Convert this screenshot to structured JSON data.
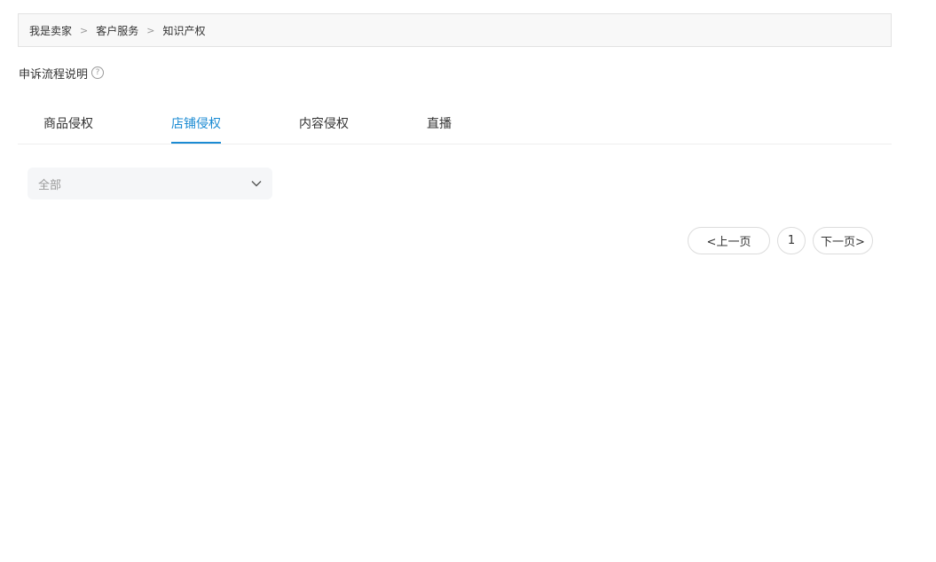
{
  "breadcrumb": {
    "items": [
      "我是卖家",
      "客户服务",
      "知识产权"
    ],
    "separator": ">"
  },
  "appeal": {
    "label": "申诉流程说明",
    "help_icon": "question-circle-icon",
    "help_glyph": "?"
  },
  "tabs": [
    {
      "label": "商品侵权",
      "active": false
    },
    {
      "label": "店铺侵权",
      "active": true
    },
    {
      "label": "内容侵权",
      "active": false
    },
    {
      "label": "直播",
      "active": false
    }
  ],
  "filter": {
    "selected": "全部",
    "icon": "chevron-down-icon"
  },
  "pagination": {
    "prev": "<上一页",
    "current_page": "1",
    "next": "下一页>"
  },
  "colors": {
    "accent": "#1b8bd3",
    "text": "#333333",
    "muted": "#999999",
    "border": "#e3e3e3",
    "select_bg": "#f5f6f8"
  }
}
